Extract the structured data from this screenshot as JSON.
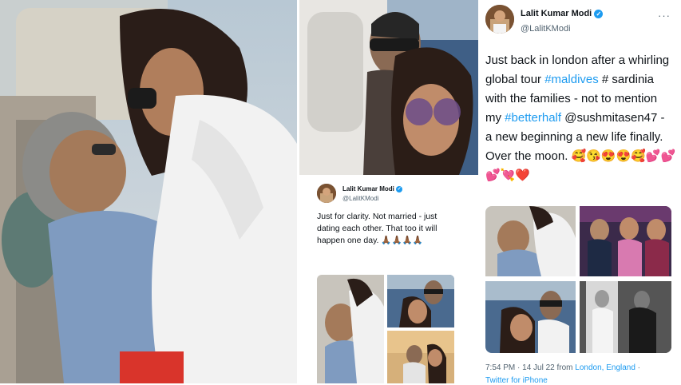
{
  "tweet_main": {
    "name": "Lalit Kumar Modi",
    "handle": "@LalitKModi",
    "more": "···",
    "text_line1": "Just back in london after a whirling",
    "text_line2_a": "global tour ",
    "text_line2_tag": "#maldives",
    "text_line2_b": " # sardinia",
    "text_line3": "with the families - not to mention",
    "text_line4_a": "my ",
    "text_line4_tag": "#betterhalf",
    "text_line4_b": " @sushmitasen47 -",
    "text_line5": "a new beginning a new life finally.",
    "text_line6": "Over the moon. 🥰😘😍😍🥰💕💕",
    "text_line7": "💕💘❤️",
    "meta_time": "7:54 PM · 14 Jul 22 from ",
    "meta_location": "London, England",
    "meta_sep": " ·",
    "meta_client": "Twitter for iPhone"
  },
  "tweet_small": {
    "name": "Lalit Kumar Modi",
    "handle": "@LalitKModi",
    "text_line1": "Just for clarity. Not married - just",
    "text_line2": "dating each other. That too it will",
    "text_line3": "happen one day. 🙏🏾🙏🏾🙏🏾🙏🏾"
  },
  "icons": {
    "verified": "✓"
  },
  "colors": {
    "link": "#1d9bf0",
    "verified": "#1d9bf0",
    "text": "#0f1419",
    "muted": "#536471"
  }
}
